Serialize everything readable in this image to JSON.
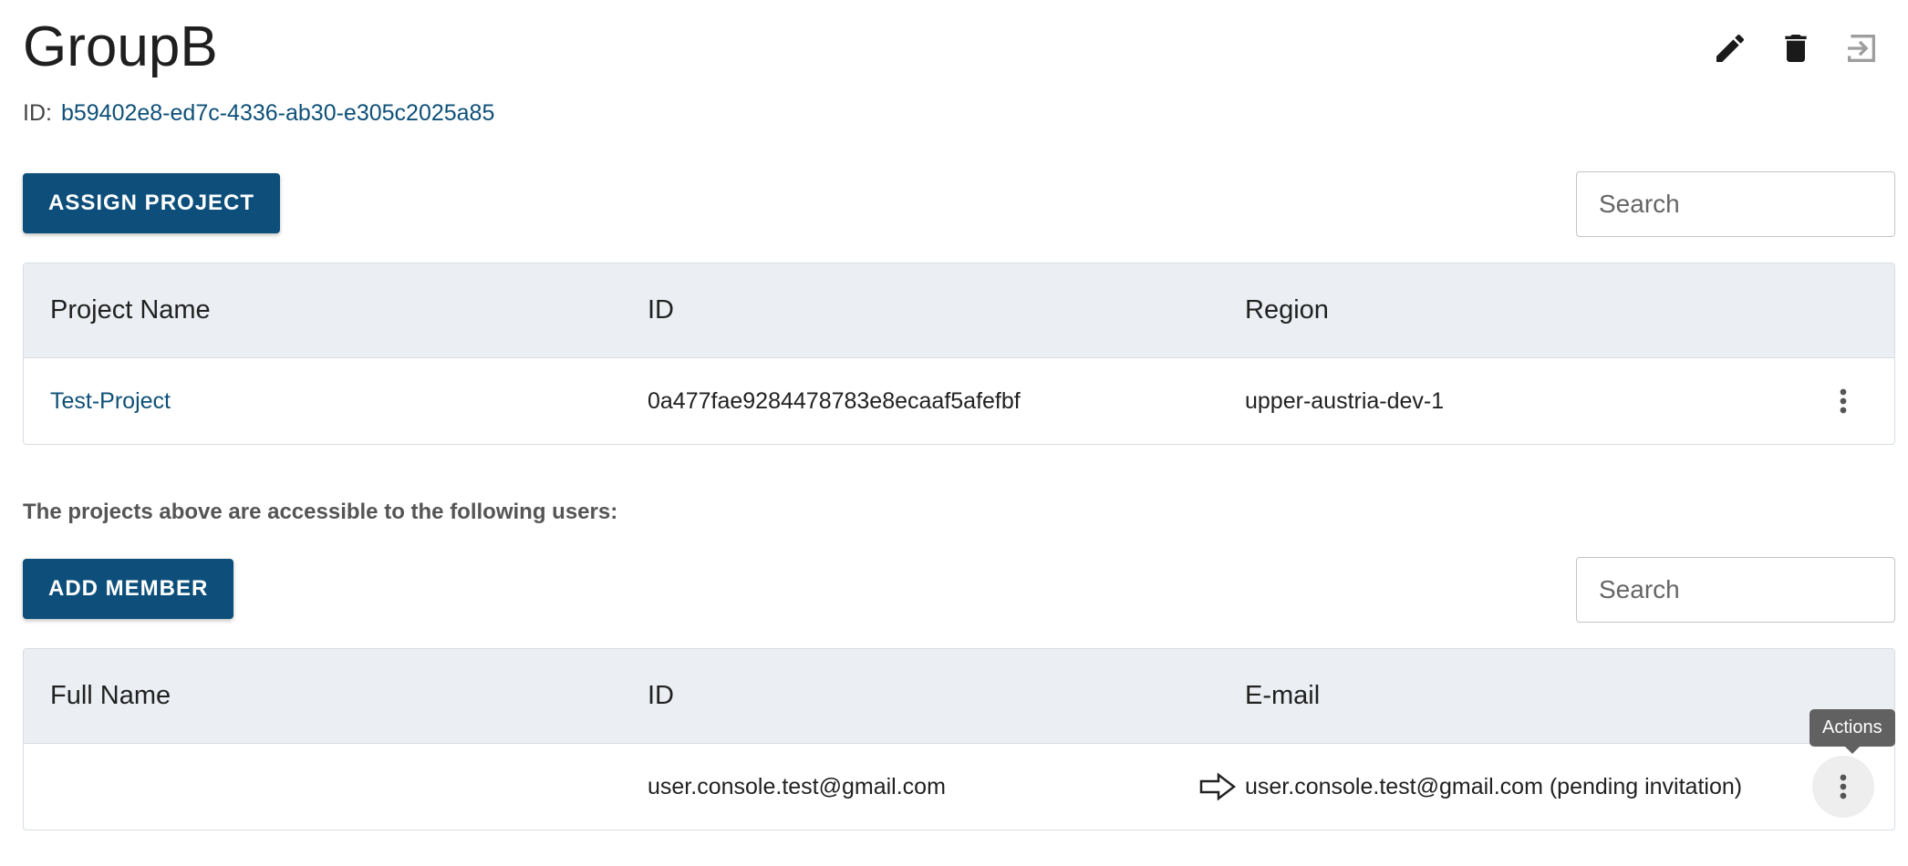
{
  "page": {
    "title": "GroupB",
    "id_label": "ID:",
    "id_value": "b59402e8-ed7c-4336-ab30-e305c2025a85"
  },
  "toolbar": {
    "icons": [
      "edit-icon",
      "delete-icon",
      "leave-group-icon"
    ]
  },
  "projects": {
    "assign_label": "ASSIGN PROJECT",
    "search_placeholder": "Search",
    "columns": [
      "Project Name",
      "ID",
      "Region"
    ],
    "rows": [
      {
        "name": "Test-Project",
        "id": "0a477fae9284478783e8ecaaf5afefbf",
        "region": "upper-austria-dev-1"
      }
    ]
  },
  "members": {
    "note": "The projects above are accessible to the following users:",
    "add_label": "ADD MEMBER",
    "search_placeholder": "Search",
    "columns": [
      "Full Name",
      "ID",
      "E-mail"
    ],
    "rows": [
      {
        "full_name": "",
        "id": "user.console.test@gmail.com",
        "email": "user.console.test@gmail.com (pending invitation)"
      }
    ]
  },
  "tooltip": {
    "text": "Actions"
  },
  "colors": {
    "primary": "#0d4f7a",
    "header_bg": "#ebeff3",
    "link": "#0e5078"
  }
}
